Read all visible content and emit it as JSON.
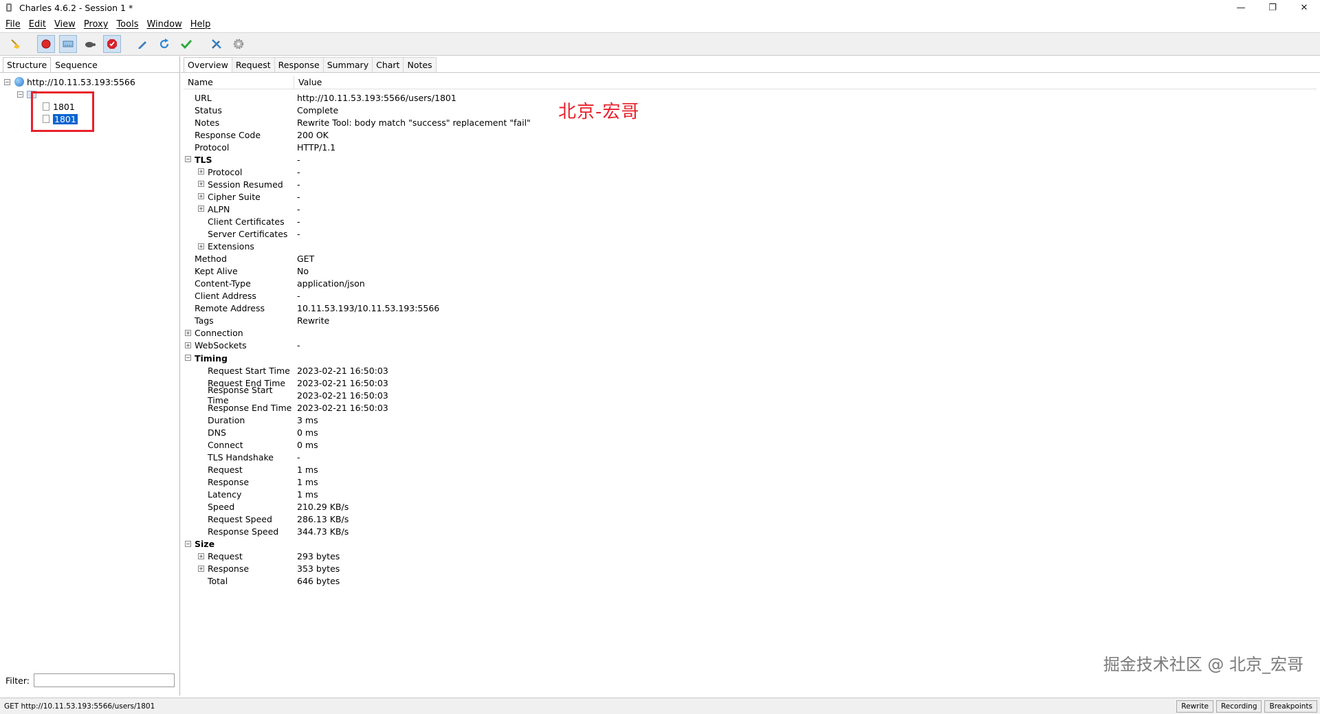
{
  "window": {
    "title": "Charles 4.6.2 - Session 1 *",
    "minimize": "—",
    "restore": "❐",
    "close": "✕"
  },
  "menu": [
    "File",
    "Edit",
    "View",
    "Proxy",
    "Tools",
    "Window",
    "Help"
  ],
  "toolbar": {
    "buttons": [
      {
        "icon": "broom-icon",
        "active": false
      },
      {
        "icon": "record-icon",
        "active": true
      },
      {
        "icon": "throttle-icon",
        "active": true
      },
      {
        "icon": "turtle-icon",
        "active": false
      },
      {
        "icon": "breakpoint-icon",
        "active": true
      },
      {
        "icon": "pen-icon",
        "active": false
      },
      {
        "icon": "refresh-icon",
        "active": false
      },
      {
        "icon": "check-icon",
        "active": false
      },
      {
        "icon": "tools-icon",
        "active": false
      },
      {
        "icon": "gear-icon",
        "active": false
      }
    ]
  },
  "left": {
    "tabs": [
      "Structure",
      "Sequence"
    ],
    "host": "http://10.11.53.193:5566",
    "nodes": [
      "1801",
      "1801"
    ],
    "filter_label": "Filter:",
    "filter_value": ""
  },
  "right": {
    "tabs": [
      "Overview",
      "Request",
      "Response",
      "Summary",
      "Chart",
      "Notes"
    ],
    "col_name": "Name",
    "col_value": "Value",
    "rows": [
      {
        "name": "URL",
        "value": "http://10.11.53.193:5566/users/1801",
        "indent": 1
      },
      {
        "name": "Status",
        "value": "Complete",
        "indent": 1
      },
      {
        "name": "Notes",
        "value": "Rewrite Tool: body match \"success\" replacement \"fail\"",
        "indent": 1
      },
      {
        "name": "Response Code",
        "value": "200 OK",
        "indent": 1
      },
      {
        "name": "Protocol",
        "value": "HTTP/1.1",
        "indent": 1
      },
      {
        "name": "TLS",
        "value": "-",
        "indent": 1,
        "bold": true,
        "exp": "⊟"
      },
      {
        "name": "Protocol",
        "value": "-",
        "indent": 2,
        "exp": "⊞"
      },
      {
        "name": "Session Resumed",
        "value": "-",
        "indent": 2,
        "exp": "⊞"
      },
      {
        "name": "Cipher Suite",
        "value": "-",
        "indent": 2,
        "exp": "⊞"
      },
      {
        "name": "ALPN",
        "value": "-",
        "indent": 2,
        "exp": "⊞"
      },
      {
        "name": "Client Certificates",
        "value": "-",
        "indent": 2
      },
      {
        "name": "Server Certificates",
        "value": "-",
        "indent": 2
      },
      {
        "name": "Extensions",
        "value": "",
        "indent": 2,
        "exp": "⊞"
      },
      {
        "name": "Method",
        "value": "GET",
        "indent": 1
      },
      {
        "name": "Kept Alive",
        "value": "No",
        "indent": 1
      },
      {
        "name": "Content-Type",
        "value": "application/json",
        "indent": 1
      },
      {
        "name": "Client Address",
        "value": "-",
        "indent": 1
      },
      {
        "name": "Remote Address",
        "value": "10.11.53.193/10.11.53.193:5566",
        "indent": 1
      },
      {
        "name": "Tags",
        "value": "Rewrite",
        "indent": 1
      },
      {
        "name": "Connection",
        "value": "",
        "indent": 1,
        "exp": "⊞"
      },
      {
        "name": "WebSockets",
        "value": "-",
        "indent": 1,
        "exp": "⊞"
      },
      {
        "name": "Timing",
        "value": "",
        "indent": 1,
        "bold": true,
        "exp": "⊟"
      },
      {
        "name": "Request Start Time",
        "value": "2023-02-21 16:50:03",
        "indent": 2
      },
      {
        "name": "Request End Time",
        "value": "2023-02-21 16:50:03",
        "indent": 2
      },
      {
        "name": "Response Start Time",
        "value": "2023-02-21 16:50:03",
        "indent": 2
      },
      {
        "name": "Response End Time",
        "value": "2023-02-21 16:50:03",
        "indent": 2
      },
      {
        "name": "Duration",
        "value": "3 ms",
        "indent": 2
      },
      {
        "name": "DNS",
        "value": "0 ms",
        "indent": 2
      },
      {
        "name": "Connect",
        "value": "0 ms",
        "indent": 2
      },
      {
        "name": "TLS Handshake",
        "value": "-",
        "indent": 2
      },
      {
        "name": "Request",
        "value": "1 ms",
        "indent": 2
      },
      {
        "name": "Response",
        "value": "1 ms",
        "indent": 2
      },
      {
        "name": "Latency",
        "value": "1 ms",
        "indent": 2
      },
      {
        "name": "Speed",
        "value": "210.29 KB/s",
        "indent": 2
      },
      {
        "name": "Request Speed",
        "value": "286.13 KB/s",
        "indent": 2
      },
      {
        "name": "Response Speed",
        "value": "344.73 KB/s",
        "indent": 2
      },
      {
        "name": "Size",
        "value": "",
        "indent": 1,
        "bold": true,
        "exp": "⊟"
      },
      {
        "name": "Request",
        "value": "293 bytes",
        "indent": 2,
        "exp": "⊞"
      },
      {
        "name": "Response",
        "value": "353 bytes",
        "indent": 2,
        "exp": "⊞"
      },
      {
        "name": "Total",
        "value": "646 bytes",
        "indent": 2
      }
    ],
    "annotation": "北京-宏哥",
    "watermark": "掘金技术社区 @ 北京_宏哥"
  },
  "status": {
    "text": "GET http://10.11.53.193:5566/users/1801",
    "buttons": [
      "Rewrite",
      "Recording",
      "Breakpoints"
    ]
  },
  "colors": {
    "selection": "#0a64d0",
    "highlight_box": "#e8202a",
    "annotation": "#e8202a"
  }
}
